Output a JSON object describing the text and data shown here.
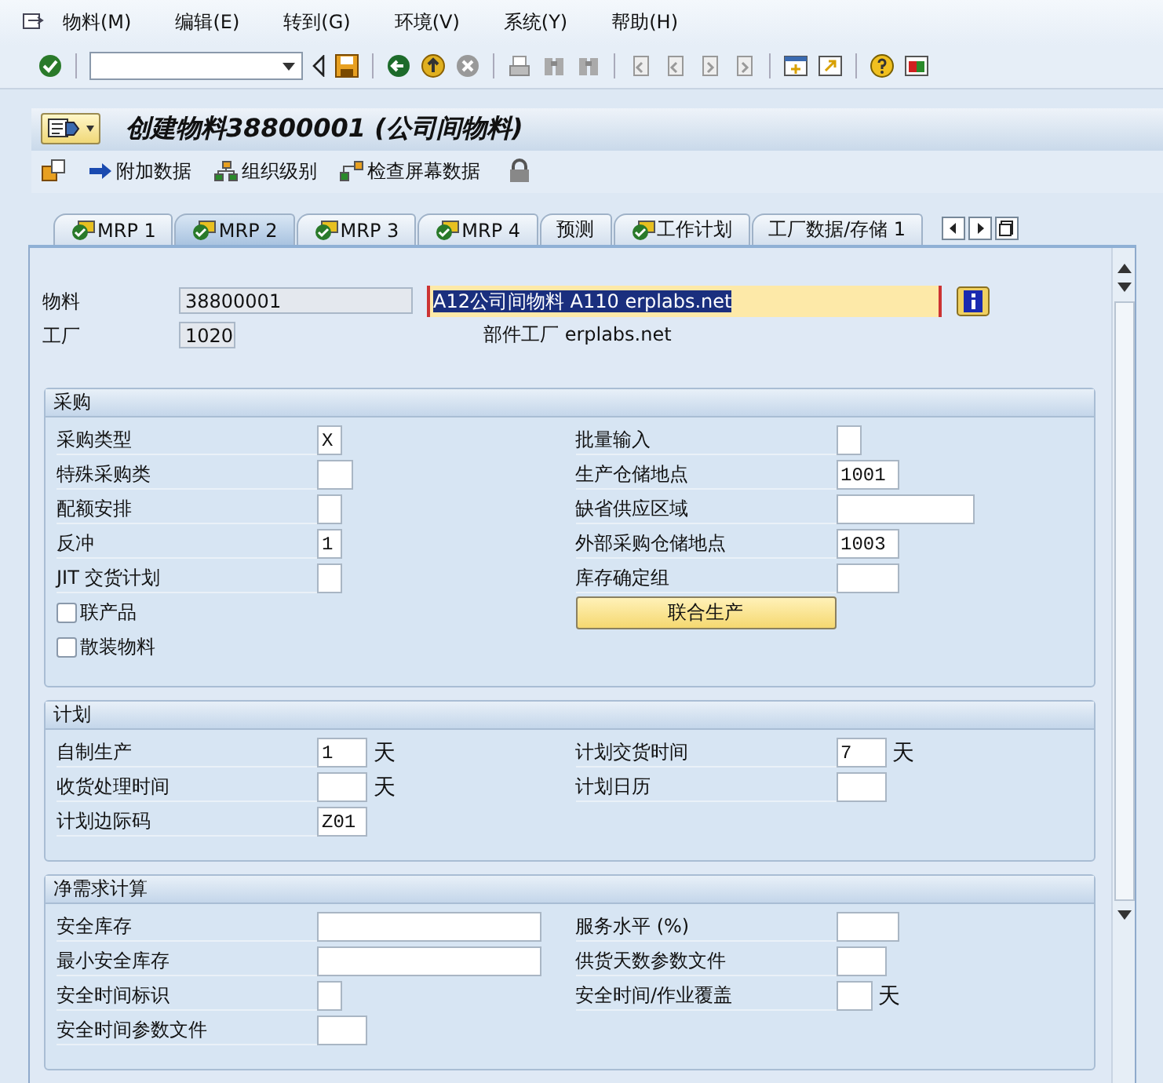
{
  "menu": [
    {
      "label": "物料(M)"
    },
    {
      "label": "编辑(E)"
    },
    {
      "label": "转到(G)"
    },
    {
      "label": "环境(V)"
    },
    {
      "label": "系统(Y)"
    },
    {
      "label": "帮助(H)"
    }
  ],
  "title": "创建物料38800001 (公司间物料)",
  "app_toolbar": [
    {
      "label": "附加数据",
      "kind": "arrow"
    },
    {
      "label": "组织级别",
      "kind": "tree"
    },
    {
      "label": "检查屏幕数据",
      "kind": "check"
    }
  ],
  "tabs": [
    {
      "label": "MRP 1",
      "selected": false,
      "complete": true
    },
    {
      "label": "MRP 2",
      "selected": true,
      "complete": true
    },
    {
      "label": "MRP 3",
      "selected": false,
      "complete": true
    },
    {
      "label": "MRP 4",
      "selected": false,
      "complete": true
    },
    {
      "label": "预测",
      "selected": false,
      "complete": false
    },
    {
      "label": "工作计划",
      "selected": false,
      "complete": true
    },
    {
      "label": "工厂数据/存储 1",
      "selected": false,
      "complete": false
    }
  ],
  "header": {
    "material_label": "物料",
    "material": "38800001",
    "description": "A12公司间物料 A110 erplabs.net",
    "plant_label": "工厂",
    "plant": "1020",
    "plant_text": "部件工厂 erplabs.net"
  },
  "sections": [
    {
      "title": "采购",
      "left": [
        {
          "kind": "tiny",
          "label": "采购类型",
          "value": "X"
        },
        {
          "kind": "small",
          "label": "特殊采购类"
        },
        {
          "kind": "tiny",
          "label": "配额安排"
        },
        {
          "kind": "tiny",
          "label": "反冲",
          "value": "1"
        },
        {
          "kind": "tiny",
          "label": "JIT 交货计划"
        },
        {
          "kind": "checkbox",
          "label": "联产品",
          "checked": false
        },
        {
          "kind": "checkbox",
          "label": "散装物料",
          "checked": false
        }
      ],
      "right": [
        {
          "kind": "tiny",
          "label": "批量输入"
        },
        {
          "kind": "medium",
          "label": "生产仓储地点",
          "value": "1001"
        },
        {
          "kind": "wide",
          "label": "缺省供应区域"
        },
        {
          "kind": "medium",
          "label": "外部采购仓储地点",
          "value": "1003"
        },
        {
          "kind": "medium",
          "label": "库存确定组"
        },
        {
          "kind": "button",
          "label": "联合生产"
        }
      ]
    },
    {
      "title": "计划",
      "left": [
        {
          "kind": "short",
          "label": "自制生产",
          "value": "1",
          "unit": "天"
        },
        {
          "kind": "short",
          "label": "收货处理时间",
          "unit": "天"
        },
        {
          "kind": "short",
          "label": "计划边际码",
          "value": "Z01"
        }
      ],
      "right": [
        {
          "kind": "short",
          "label": "计划交货时间",
          "value": "7",
          "unit": "天"
        },
        {
          "kind": "short",
          "label": "计划日历"
        }
      ]
    },
    {
      "title": "净需求计算",
      "left": [
        {
          "kind": "long",
          "label": "安全库存"
        },
        {
          "kind": "long",
          "label": "最小安全库存"
        },
        {
          "kind": "tiny",
          "label": "安全时间标识"
        },
        {
          "kind": "short",
          "label": "安全时间参数文件"
        }
      ],
      "right": [
        {
          "kind": "medium",
          "label": "服务水平 (%)"
        },
        {
          "kind": "short",
          "label": "供货天数参数文件"
        },
        {
          "kind": "small",
          "label": "安全时间/作业覆盖",
          "unit": "天"
        }
      ]
    }
  ]
}
